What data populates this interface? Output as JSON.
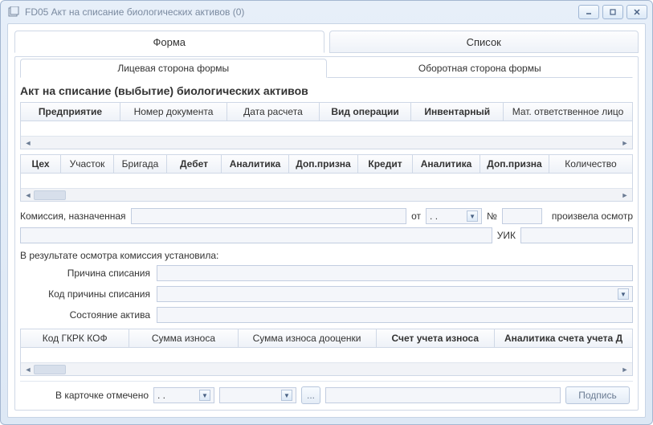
{
  "window": {
    "title": "FD05 Акт на списание биологических активов (0)"
  },
  "main_tabs": {
    "form": "Форма",
    "list": "Список"
  },
  "sub_tabs": {
    "front": "Лицевая сторона формы",
    "back": "Оборотная сторона формы"
  },
  "heading": "Акт на списание (выбытие) биологических активов",
  "grid1": {
    "cols": [
      "Предприятие",
      "Номер документа",
      "Дата расчета",
      "Вид операции",
      "Инвентарный",
      "Мат. ответственное лицо"
    ]
  },
  "grid2": {
    "cols": [
      "Цех",
      "Участок",
      "Бригада",
      "Дебет",
      "Аналитика",
      "Доп.призна",
      "Кредит",
      "Аналитика",
      "Доп.призна",
      "Количество"
    ]
  },
  "commission": {
    "label": "Комиссия, назначенная",
    "from": "от",
    "date": ".  .",
    "numSign": "№",
    "did": "произвела осмотр",
    "uik": "УИК"
  },
  "result_line": "В результате осмотра комиссия установила:",
  "fields": {
    "reason": "Причина списания",
    "reason_code": "Код причины списания",
    "asset_state": "Состояние актива"
  },
  "grid3": {
    "cols": [
      "Код ГКРК КОФ",
      "Сумма износа",
      "Сумма износа дооценки",
      "Счет учета износа",
      "Аналитика счета учета Д"
    ]
  },
  "bottom": {
    "marked": "В карточке отмечено",
    "date": ".  .",
    "ellipsis": "...",
    "sign": "Подпись"
  }
}
